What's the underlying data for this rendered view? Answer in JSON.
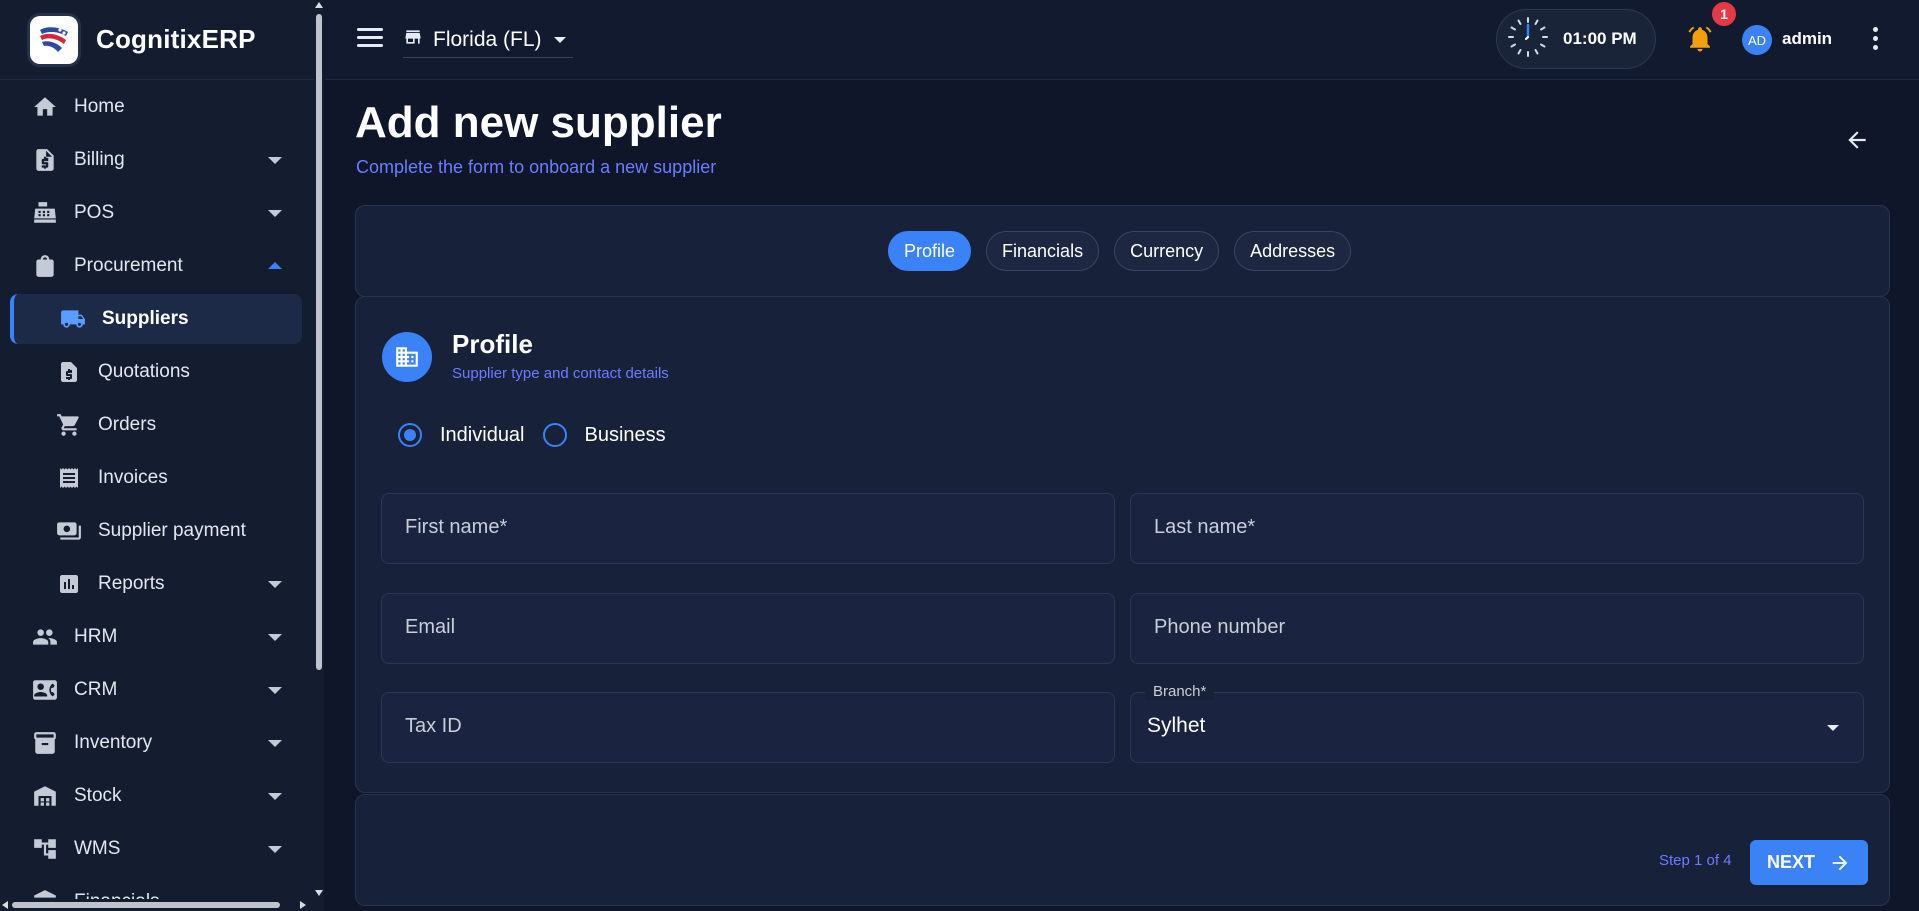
{
  "app": {
    "name": "CognitixERP"
  },
  "sidebar": {
    "items": [
      {
        "label": "Home",
        "icon": "home-icon"
      },
      {
        "label": "Billing",
        "icon": "billing-icon"
      },
      {
        "label": "POS",
        "icon": "cash-register-icon"
      },
      {
        "label": "Procurement",
        "icon": "shopping-bag-icon"
      },
      {
        "label": "Suppliers",
        "icon": "truck-icon"
      },
      {
        "label": "Quotations",
        "icon": "document-dollar-icon"
      },
      {
        "label": "Orders",
        "icon": "cart-icon"
      },
      {
        "label": "Invoices",
        "icon": "receipt-icon"
      },
      {
        "label": "Supplier payment",
        "icon": "payment-icon"
      },
      {
        "label": "Reports",
        "icon": "bar-chart-icon"
      },
      {
        "label": "HRM",
        "icon": "people-icon"
      },
      {
        "label": "CRM",
        "icon": "contact-card-icon"
      },
      {
        "label": "Inventory",
        "icon": "archive-icon"
      },
      {
        "label": "Stock",
        "icon": "warehouse-icon"
      },
      {
        "label": "WMS",
        "icon": "hierarchy-icon"
      },
      {
        "label": "Financials",
        "icon": "bank-icon"
      }
    ]
  },
  "topbar": {
    "store": "Florida (FL)",
    "time": "01:00 PM",
    "notification_count": "1",
    "avatar_initials": "AD",
    "user": "admin"
  },
  "page": {
    "title": "Add new supplier",
    "subtitle": "Complete the form to onboard a new supplier"
  },
  "tabs": [
    "Profile",
    "Financials",
    "Currency",
    "Addresses"
  ],
  "section": {
    "title": "Profile",
    "subtitle": "Supplier type and contact details"
  },
  "supplier_type": {
    "options": [
      "Individual",
      "Business"
    ],
    "selected": "Individual"
  },
  "fields": {
    "first_name": "First name*",
    "last_name": "Last name*",
    "email": "Email",
    "phone": "Phone number",
    "tax_id": "Tax ID",
    "branch_label": "Branch*",
    "branch_value": "Sylhet"
  },
  "footer": {
    "step": "Step 1 of 4",
    "next": "NEXT"
  },
  "colors": {
    "accent": "#3b82f6",
    "subtitle": "#6d7cff",
    "background": "#0f1629",
    "card": "#18213a",
    "badge": "#e53945"
  }
}
